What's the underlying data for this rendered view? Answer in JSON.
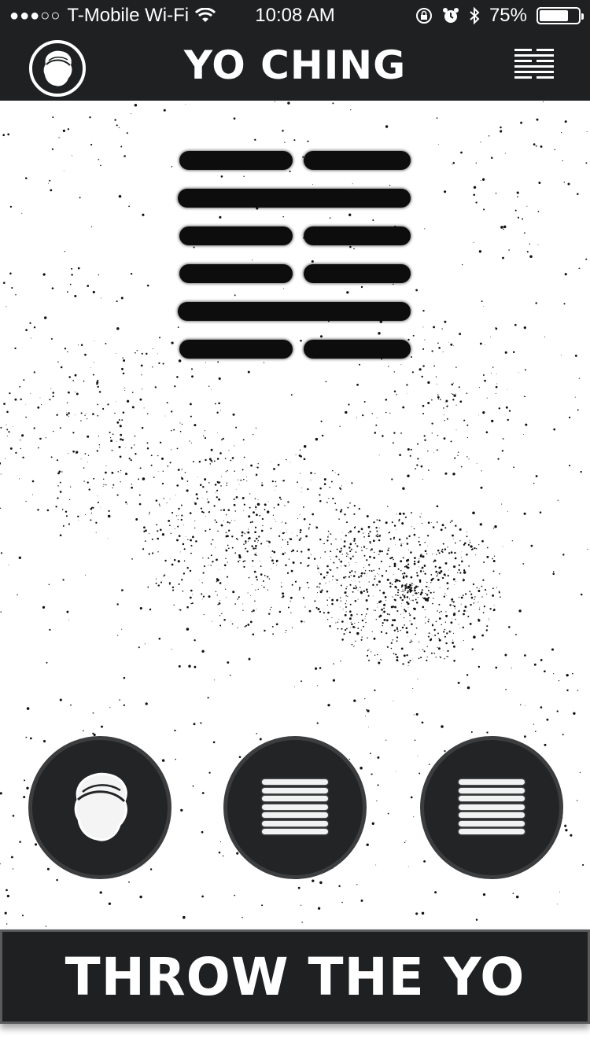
{
  "status_bar": {
    "signal": "●●●○○",
    "carrier": "T-Mobile Wi-Fi",
    "time": "10:08 AM",
    "battery_percent": "75%",
    "battery_level": 0.75,
    "icons": [
      "wifi-icon",
      "rotation-lock-icon",
      "alarm-icon",
      "bluetooth-icon",
      "battery-icon"
    ]
  },
  "header": {
    "title": "YO CHING",
    "left_icon": "face-avatar-icon",
    "right_icon": "hexagram-menu-icon"
  },
  "hexagram": {
    "lines": [
      "broken",
      "solid",
      "broken",
      "broken",
      "solid",
      "broken"
    ]
  },
  "action_buttons": [
    {
      "name": "profile",
      "icon": "face-avatar-icon"
    },
    {
      "name": "hexagram-history",
      "icon": "hexagram-icon"
    },
    {
      "name": "hexagram-list",
      "icon": "hexagram-icon"
    }
  ],
  "cta": {
    "label": "THROW THE YO"
  },
  "colors": {
    "bar": "#1e2022",
    "background": "#ffffff",
    "ink": "#0d0d0d",
    "circle_border": "#3c3d3f"
  }
}
